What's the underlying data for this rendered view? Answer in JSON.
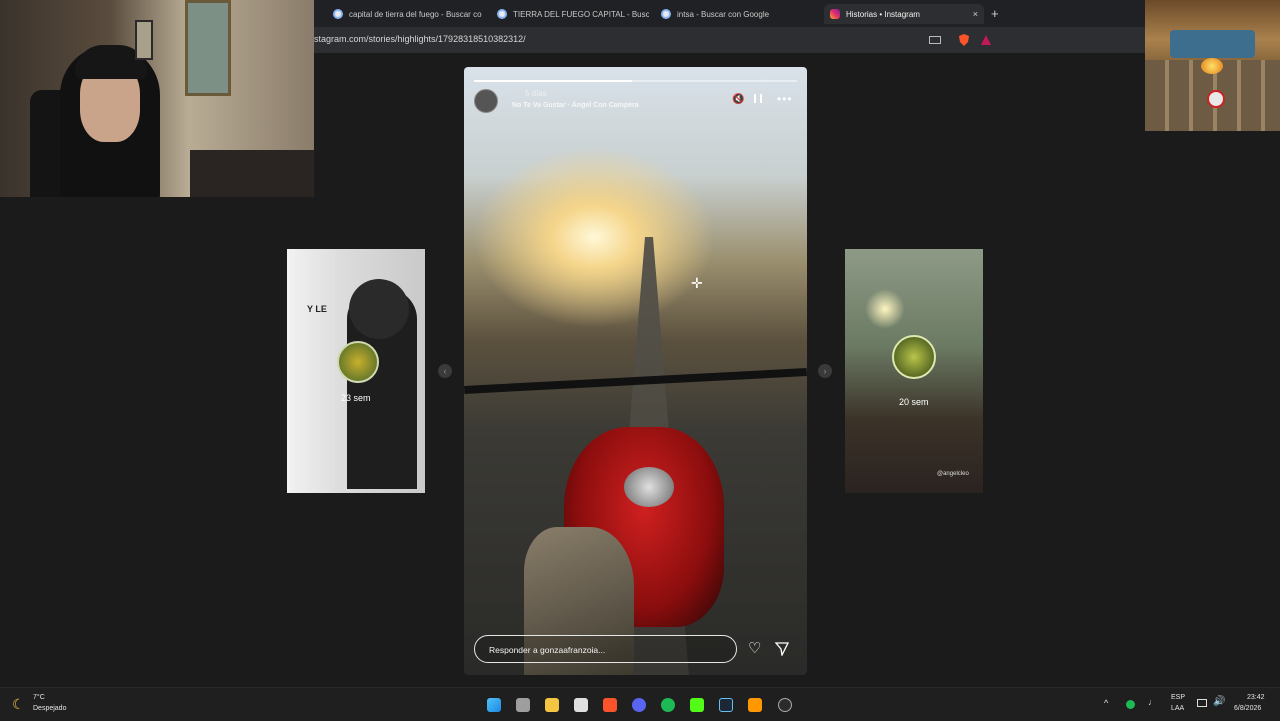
{
  "browser": {
    "tabs": [
      {
        "title": "capital de tierra del fuego - Buscar co",
        "active": false
      },
      {
        "title": "TIERRA DEL FUEGO CAPITAL - Buscar",
        "active": false
      },
      {
        "title": "intsa - Buscar con Google",
        "active": false
      },
      {
        "title": "Historias • Instagram",
        "active": true
      }
    ],
    "new_tab": "+",
    "close_tab": "×",
    "url": "stagram.com/stories/highlights/17928318510382312/"
  },
  "story": {
    "time_ago": "5 días",
    "audio": "No Te Va Gustar · Ángel Con Campera",
    "reply_placeholder": "Responder a gonzaafranzoia...",
    "progress_fraction": 0.49
  },
  "prev_story": {
    "overlay_text": "Y LE",
    "time": "23 sem"
  },
  "next_story": {
    "time": "20 sem",
    "watermark": "@angelcleo"
  },
  "nav": {
    "prev": "‹",
    "next": "›"
  },
  "taskbar": {
    "weather_temp": "7°C",
    "weather_desc": "Despejado",
    "lang_top": "ESP",
    "lang_bottom": "LAA",
    "time": "23:42",
    "date": "6/8/2026"
  },
  "colors": {
    "accent_instagram": "#e1306c",
    "brave": "#fb542b",
    "spotify": "#1db954"
  }
}
